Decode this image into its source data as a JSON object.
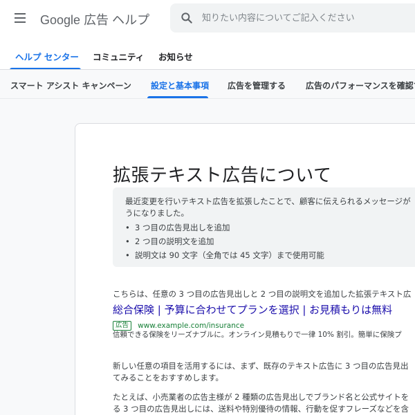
{
  "header": {
    "menu_icon": "hamburger-menu-icon",
    "product_brand": "Google",
    "product_name": "広告 ヘルプ",
    "search": {
      "icon": "search-icon",
      "placeholder": "知りたい内容についてご記入ください",
      "value": ""
    }
  },
  "primary_tabs": [
    {
      "label": "ヘルプ センター",
      "active": true
    },
    {
      "label": "コミュニティ",
      "active": false
    },
    {
      "label": "お知らせ",
      "active": false
    }
  ],
  "secondary_tabs": [
    {
      "label": "スマート アシスト キャンペーン",
      "active": false
    },
    {
      "label": "設定と基本事項",
      "active": true
    },
    {
      "label": "広告を管理する",
      "active": false
    },
    {
      "label": "広告のパフォーマンスを確認す",
      "active": false
    }
  ],
  "article": {
    "title": "拡張テキスト広告について",
    "callout": {
      "intro": "最近変更を行いテキスト広告を拡張したことで、顧客に伝えられるメッセージが\nうになりました。",
      "items": [
        "3 つ目の広告見出しを追加",
        "2 つ目の説明文を追加",
        "説明文は 90 文字（全角では 45 文字）まで使用可能"
      ]
    },
    "example_intro": "こちらは、任意の 3 つ目の広告見出しと 2 つ目の説明文を追加した拡張テキスト広",
    "ad_example": {
      "headline": "総合保険 | 予算に合わせてプランを選択 | お見積もりは無料",
      "badge": "広告",
      "url": "www.example.com/insurance",
      "description": "信頼できる保険をリーズナブルに。オンライン見積もりで一律 10% 割引。簡単に保険プ"
    },
    "para2_line1": "新しい任意の項目を活用するには、まず、既存のテキスト広告に 3 つ目の広告見出",
    "para2_line2": "てみることをおすすめします。",
    "para3_line1": "たとえば、小売業者の広告主様が 2 種類の広告見出しでブランド名と公式サイトを",
    "para3_line2": "る 3 つ目の広告見出しには、送料や特別優待の情報、行動を促すフレーズなどを含"
  },
  "colors": {
    "accent": "#1a73e8",
    "ad_headline": "#1a0dab",
    "ad_green": "#188038",
    "text": "#202124"
  }
}
